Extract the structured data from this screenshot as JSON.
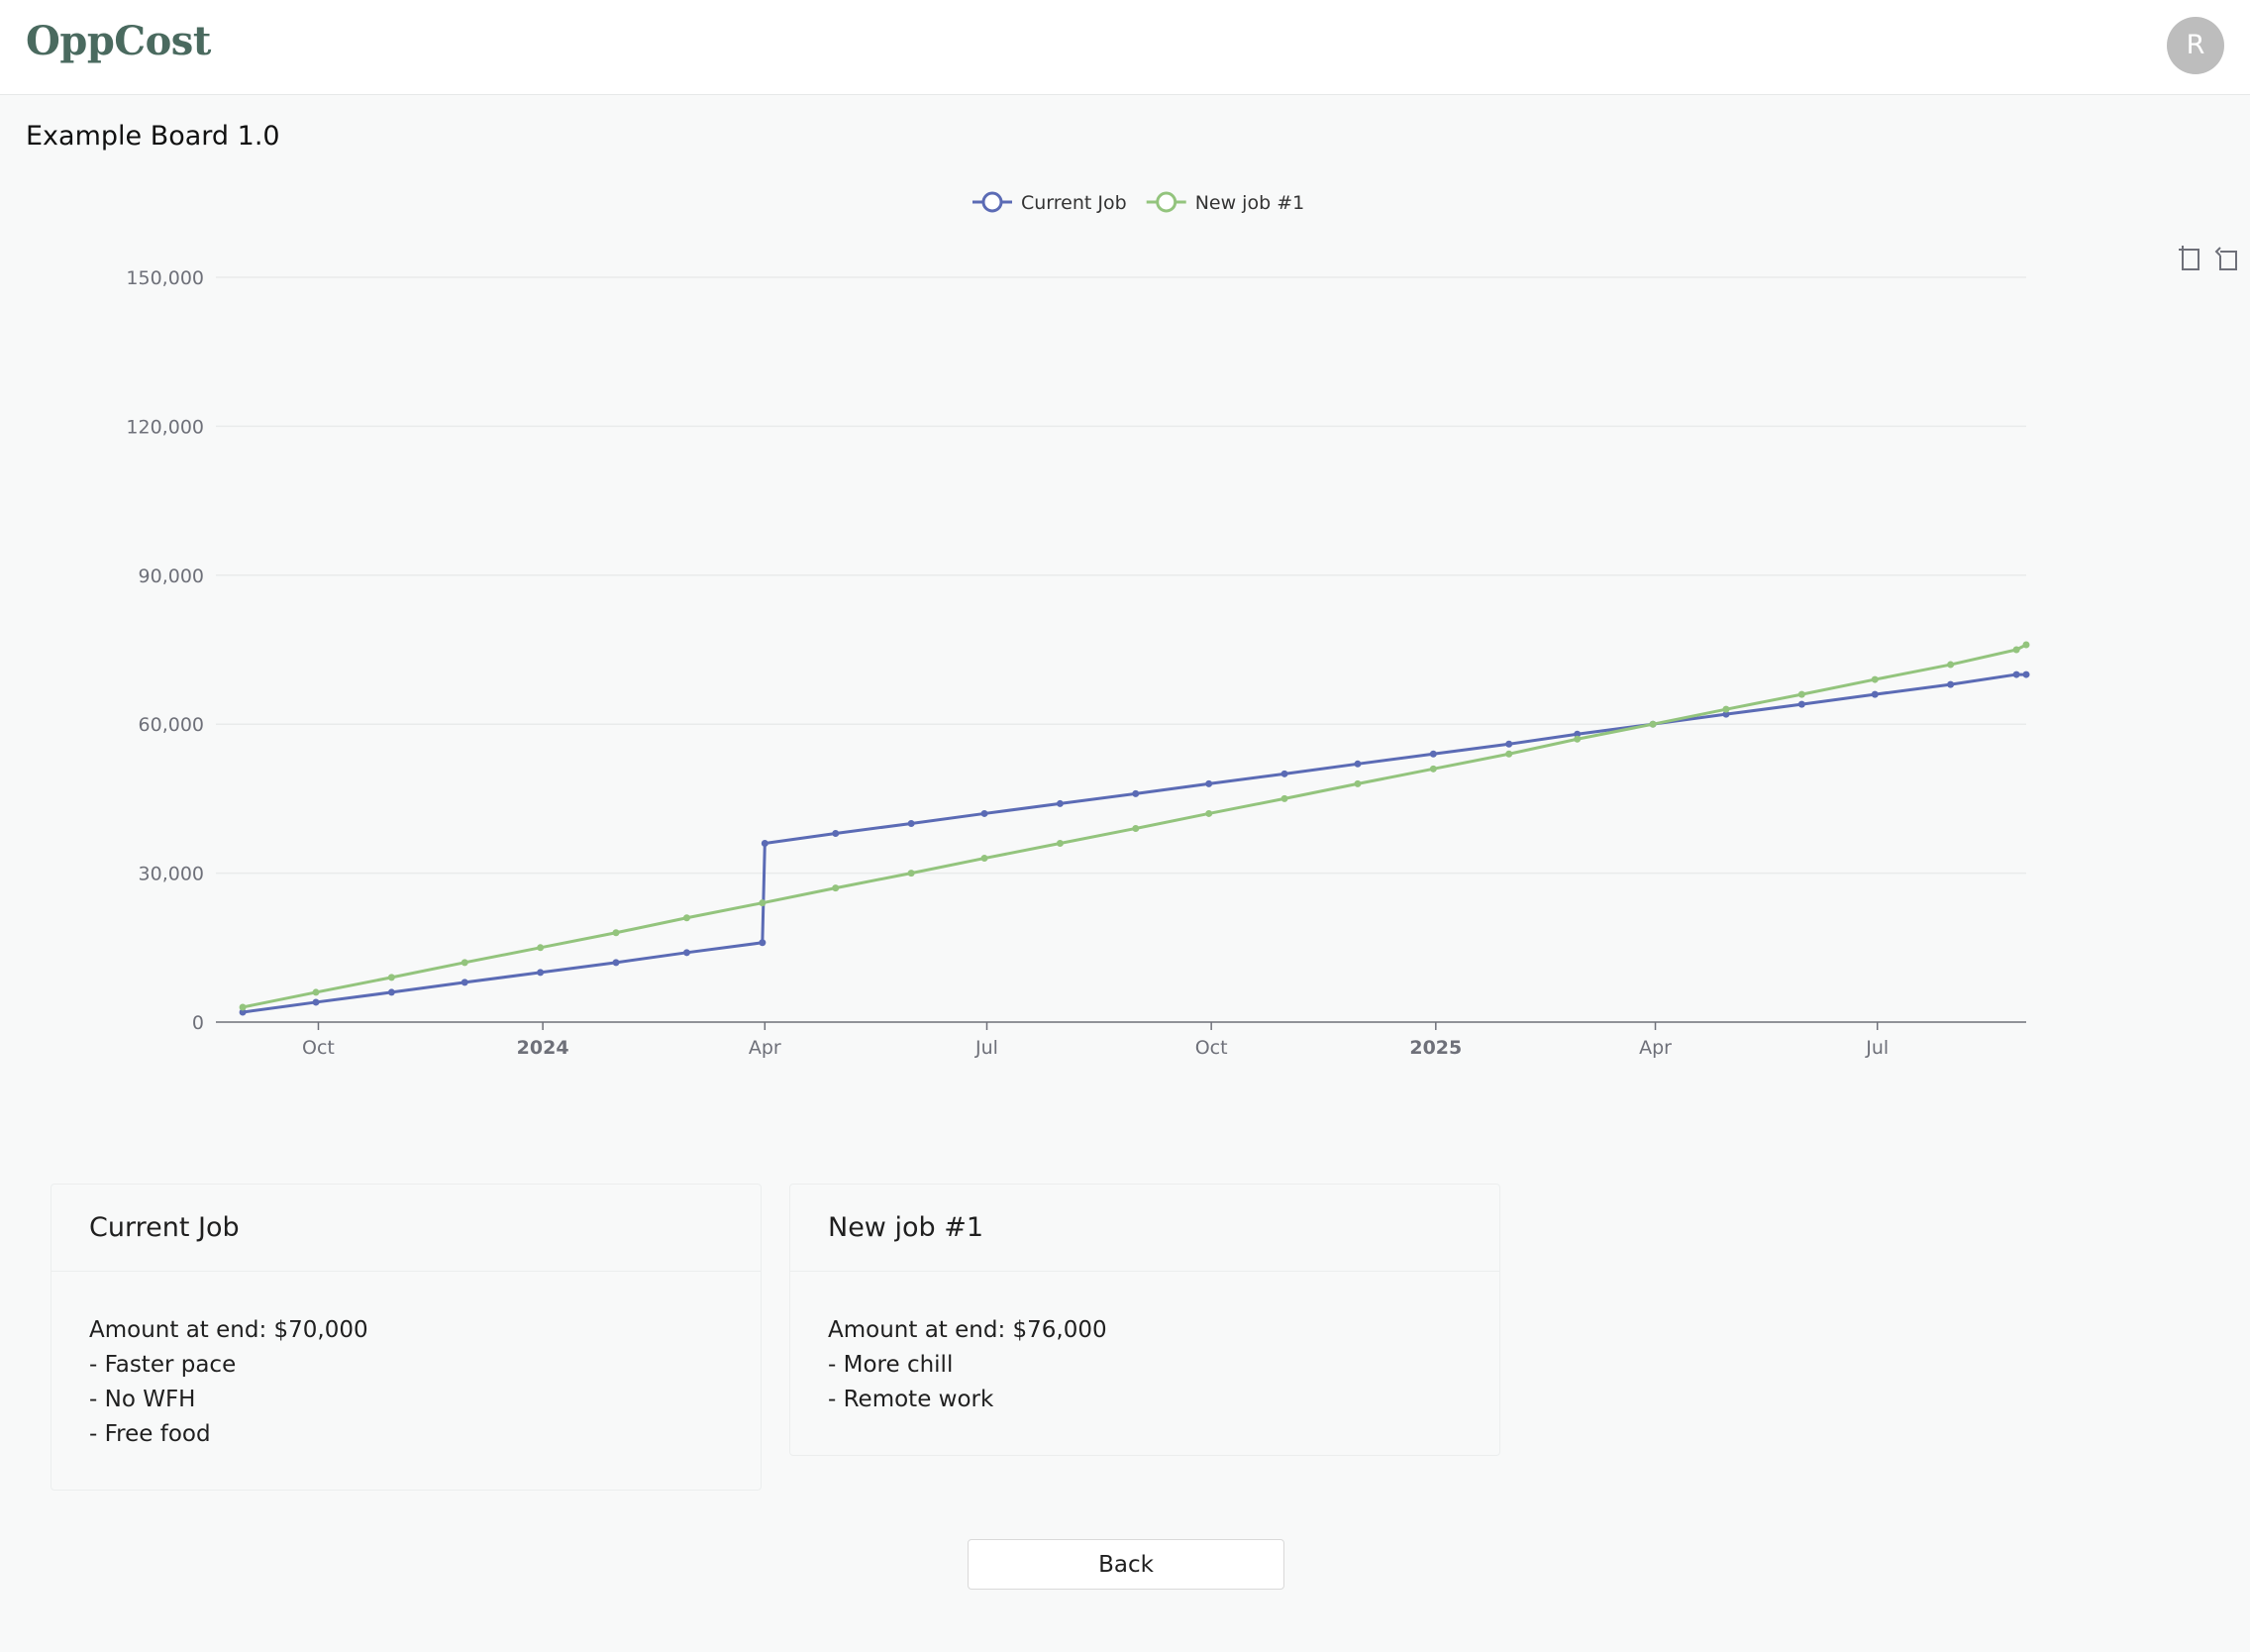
{
  "app": {
    "logo": "OppCost",
    "avatar_initial": "R"
  },
  "board": {
    "title": "Example Board 1.0"
  },
  "toolbox": {
    "icons": [
      "zoom-select-icon",
      "zoom-reset-icon"
    ]
  },
  "colors": {
    "current_job": "#5b6bb5",
    "new_job": "#93c47d",
    "grid": "#e9ebeb",
    "axis": "#6e7079"
  },
  "chart_data": {
    "type": "line",
    "title": "",
    "xlabel": "",
    "ylabel": "",
    "legend_position": "top-center",
    "grid": true,
    "ylim": [
      0,
      150000
    ],
    "y_ticks": [
      "0",
      "30,000",
      "60,000",
      "90,000",
      "120,000",
      "150,000"
    ],
    "x_range": [
      "2023-08-20",
      "2025-08-31"
    ],
    "x_ticks": [
      {
        "date": "2023-10-01",
        "label": "Oct",
        "bold": false
      },
      {
        "date": "2024-01-01",
        "label": "2024",
        "bold": true
      },
      {
        "date": "2024-04-01",
        "label": "Apr",
        "bold": false
      },
      {
        "date": "2024-07-01",
        "label": "Jul",
        "bold": false
      },
      {
        "date": "2024-10-01",
        "label": "Oct",
        "bold": false
      },
      {
        "date": "2025-01-01",
        "label": "2025",
        "bold": true
      },
      {
        "date": "2025-04-01",
        "label": "Apr",
        "bold": false
      },
      {
        "date": "2025-07-01",
        "label": "Jul",
        "bold": false
      }
    ],
    "series": [
      {
        "name": "Current Job",
        "color": "#5b6bb5",
        "points": [
          [
            "2023-08-31",
            2000
          ],
          [
            "2023-09-30",
            4000
          ],
          [
            "2023-10-31",
            6000
          ],
          [
            "2023-11-30",
            8000
          ],
          [
            "2023-12-31",
            10000
          ],
          [
            "2024-01-31",
            12000
          ],
          [
            "2024-02-29",
            14000
          ],
          [
            "2024-03-31",
            16000
          ],
          [
            "2024-04-01",
            36000
          ],
          [
            "2024-04-30",
            38000
          ],
          [
            "2024-05-31",
            40000
          ],
          [
            "2024-06-30",
            42000
          ],
          [
            "2024-07-31",
            44000
          ],
          [
            "2024-08-31",
            46000
          ],
          [
            "2024-09-30",
            48000
          ],
          [
            "2024-10-31",
            50000
          ],
          [
            "2024-11-30",
            52000
          ],
          [
            "2024-12-31",
            54000
          ],
          [
            "2025-01-31",
            56000
          ],
          [
            "2025-02-28",
            58000
          ],
          [
            "2025-03-31",
            60000
          ],
          [
            "2025-04-30",
            62000
          ],
          [
            "2025-05-31",
            64000
          ],
          [
            "2025-06-30",
            66000
          ],
          [
            "2025-07-31",
            68000
          ],
          [
            "2025-08-27",
            70000
          ],
          [
            "2025-08-31",
            70000
          ]
        ]
      },
      {
        "name": "New job #1",
        "color": "#93c47d",
        "points": [
          [
            "2023-08-31",
            3000
          ],
          [
            "2023-09-30",
            6000
          ],
          [
            "2023-10-31",
            9000
          ],
          [
            "2023-11-30",
            12000
          ],
          [
            "2023-12-31",
            15000
          ],
          [
            "2024-01-31",
            18000
          ],
          [
            "2024-02-29",
            21000
          ],
          [
            "2024-03-31",
            24000
          ],
          [
            "2024-04-30",
            27000
          ],
          [
            "2024-05-31",
            30000
          ],
          [
            "2024-06-30",
            33000
          ],
          [
            "2024-07-31",
            36000
          ],
          [
            "2024-08-31",
            39000
          ],
          [
            "2024-09-30",
            42000
          ],
          [
            "2024-10-31",
            45000
          ],
          [
            "2024-11-30",
            48000
          ],
          [
            "2024-12-31",
            51000
          ],
          [
            "2025-01-31",
            54000
          ],
          [
            "2025-02-28",
            57000
          ],
          [
            "2025-03-31",
            60000
          ],
          [
            "2025-04-30",
            63000
          ],
          [
            "2025-05-31",
            66000
          ],
          [
            "2025-06-30",
            69000
          ],
          [
            "2025-07-31",
            72000
          ],
          [
            "2025-08-27",
            75000
          ],
          [
            "2025-08-31",
            76000
          ]
        ]
      }
    ]
  },
  "cards": [
    {
      "title": "Current Job",
      "lines": [
        "Amount at end: $70,000",
        "- Faster pace",
        "- No WFH",
        "- Free food"
      ]
    },
    {
      "title": "New job #1",
      "lines": [
        "Amount at end: $76,000",
        "- More chill",
        "- Remote work"
      ]
    }
  ],
  "footer": {
    "back_label": "Back"
  }
}
